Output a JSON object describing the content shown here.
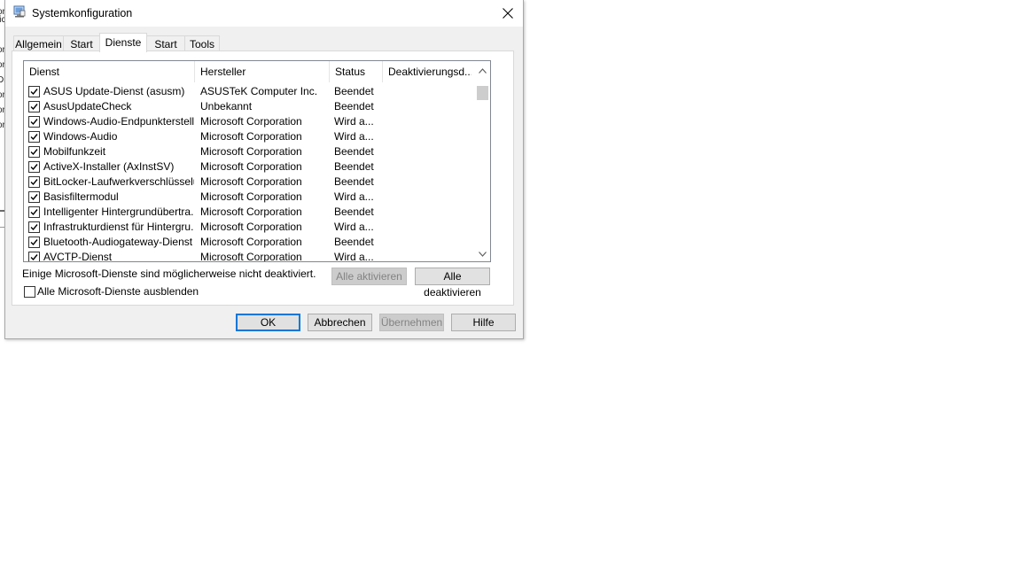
{
  "background": {
    "fragments": [
      "or",
      "lic",
      "or",
      "or",
      "Di",
      "or",
      "or",
      "or"
    ]
  },
  "window": {
    "title": "Systemkonfiguration",
    "icon": "msconfig-icon"
  },
  "tabs": [
    {
      "label": "Allgemein"
    },
    {
      "label": "Start"
    },
    {
      "label": "Dienste"
    },
    {
      "label": "Start"
    },
    {
      "label": "Tools"
    }
  ],
  "list": {
    "columns": [
      "Dienst",
      "Hersteller",
      "Status",
      "Deaktivierungsd..."
    ],
    "rows": [
      {
        "checked": true,
        "service": "ASUS Update-Dienst (asusm)",
        "vendor": "ASUSTeK Computer Inc.",
        "status": "Beendet",
        "date": ""
      },
      {
        "checked": true,
        "service": "AsusUpdateCheck",
        "vendor": "Unbekannt",
        "status": "Beendet",
        "date": ""
      },
      {
        "checked": true,
        "service": "Windows-Audio-Endpunkterstell...",
        "vendor": "Microsoft Corporation",
        "status": "Wird a...",
        "date": ""
      },
      {
        "checked": true,
        "service": "Windows-Audio",
        "vendor": "Microsoft Corporation",
        "status": "Wird a...",
        "date": ""
      },
      {
        "checked": true,
        "service": "Mobilfunkzeit",
        "vendor": "Microsoft Corporation",
        "status": "Beendet",
        "date": ""
      },
      {
        "checked": true,
        "service": "ActiveX-Installer (AxInstSV)",
        "vendor": "Microsoft Corporation",
        "status": "Beendet",
        "date": ""
      },
      {
        "checked": true,
        "service": "BitLocker-Laufwerkverschlüsselu...",
        "vendor": "Microsoft Corporation",
        "status": "Beendet",
        "date": ""
      },
      {
        "checked": true,
        "service": "Basisfiltermodul",
        "vendor": "Microsoft Corporation",
        "status": "Wird a...",
        "date": ""
      },
      {
        "checked": true,
        "service": "Intelligenter Hintergrundübertra...",
        "vendor": "Microsoft Corporation",
        "status": "Beendet",
        "date": ""
      },
      {
        "checked": true,
        "service": "Infrastrukturdienst für Hintergru...",
        "vendor": "Microsoft Corporation",
        "status": "Wird a...",
        "date": ""
      },
      {
        "checked": true,
        "service": "Bluetooth-Audiogateway-Dienst",
        "vendor": "Microsoft Corporation",
        "status": "Beendet",
        "date": ""
      },
      {
        "checked": true,
        "service": "AVCTP-Dienst",
        "vendor": "Microsoft Corporation",
        "status": "Wird a...",
        "date": ""
      }
    ]
  },
  "footer": {
    "note": "Einige Microsoft-Dienste sind möglicherweise nicht deaktiviert.",
    "enable_all": "Alle aktivieren",
    "disable_all": "Alle deaktivieren",
    "hide_ms_label": "Alle Microsoft-Dienste ausblenden",
    "hide_ms_checked": false
  },
  "buttons": {
    "ok": "OK",
    "cancel": "Abbrechen",
    "apply": "Übernehmen",
    "help": "Hilfe"
  },
  "colors": {
    "accent": "#0078d7",
    "dialog_bg": "#f0f0f0"
  }
}
